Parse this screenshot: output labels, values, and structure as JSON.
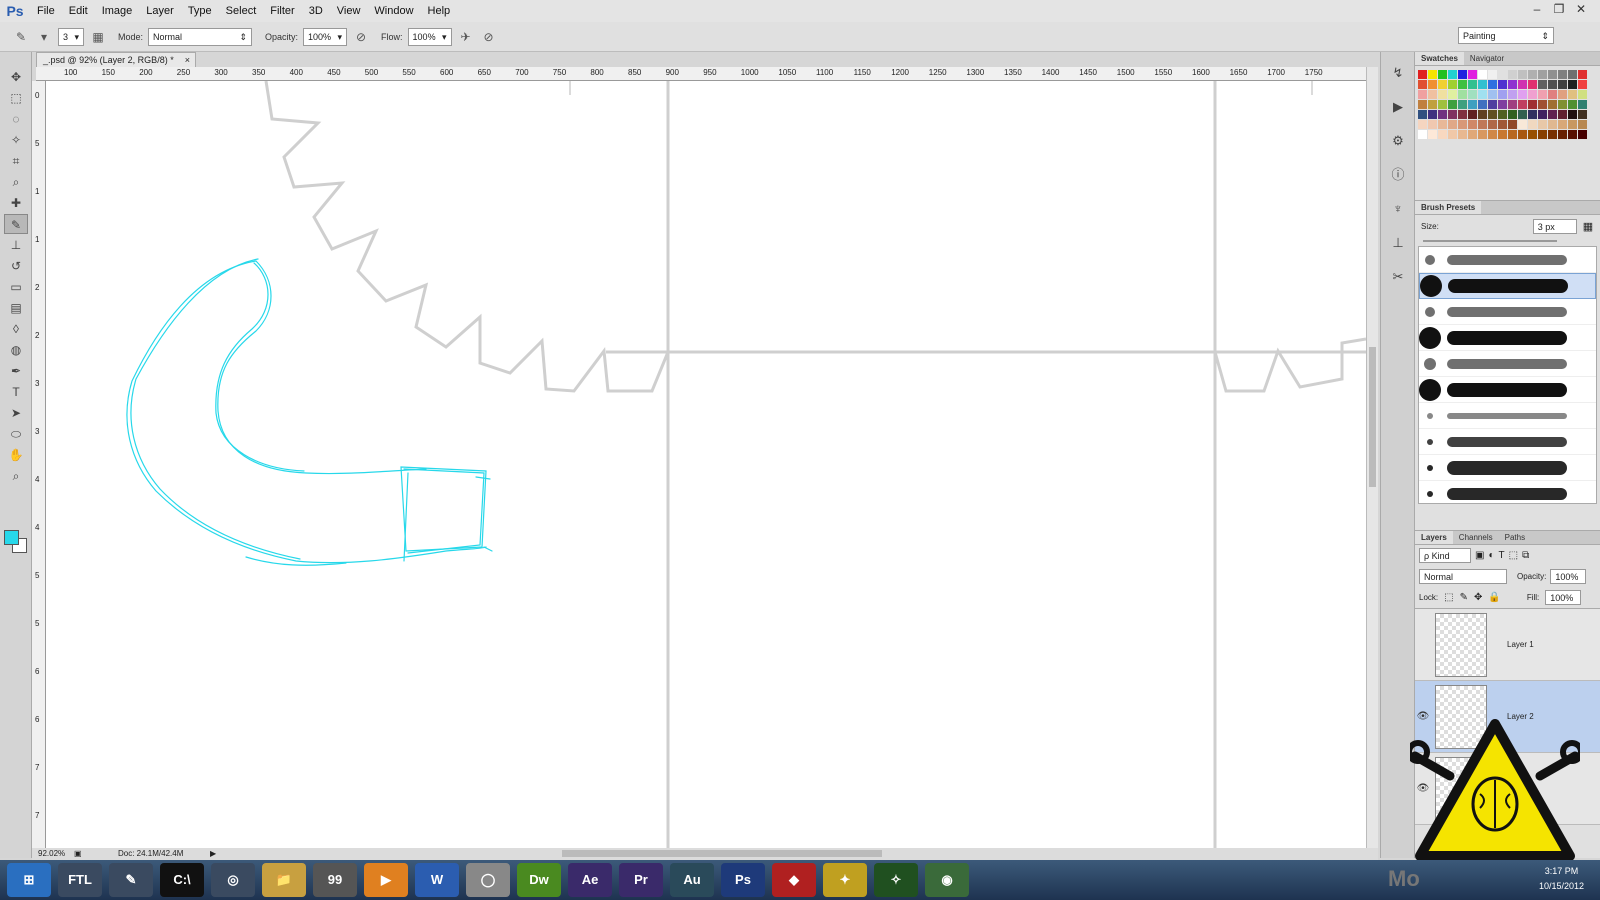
{
  "app": {
    "logo": "Ps"
  },
  "menu": [
    "File",
    "Edit",
    "Image",
    "Layer",
    "Type",
    "Select",
    "Filter",
    "3D",
    "View",
    "Window",
    "Help"
  ],
  "window_controls": [
    "–",
    "❐",
    "✕"
  ],
  "options": {
    "brush_size": "3",
    "mode_label": "Mode:",
    "mode_value": "Normal",
    "opacity_label": "Opacity:",
    "opacity_value": "100%",
    "flow_label": "Flow:",
    "flow_value": "100%",
    "workspace": "Painting"
  },
  "document": {
    "tab_title": "_.psd @ 92% (Layer 2, RGB/8) *",
    "close": "×"
  },
  "ruler_h": [
    "100",
    "150",
    "200",
    "250",
    "300",
    "350",
    "400",
    "450",
    "500",
    "550",
    "600",
    "650",
    "700",
    "750",
    "800",
    "850",
    "900",
    "950",
    "1000",
    "1050",
    "1100",
    "1150",
    "1200",
    "1250",
    "1300",
    "1350",
    "1400",
    "1450",
    "1500",
    "1550",
    "1600",
    "1650",
    "1700",
    "1750"
  ],
  "ruler_v": [
    "0",
    "5",
    "1",
    "1",
    "2",
    "2",
    "3",
    "3",
    "4",
    "4",
    "5",
    "5",
    "6",
    "6",
    "7",
    "7"
  ],
  "status": {
    "zoom": "92.02%",
    "doc": "Doc: 24.1M/42.4M"
  },
  "tools": [
    "move-icon",
    "marquee-icon",
    "lasso-icon",
    "quick-select-icon",
    "crop-icon",
    "eyedropper-icon",
    "healing-icon",
    "brush-icon",
    "stamp-icon",
    "history-brush-icon",
    "eraser-icon",
    "gradient-icon",
    "blur-icon",
    "dodge-icon",
    "pen-icon",
    "type-icon",
    "path-select-icon",
    "shape-icon",
    "hand-icon",
    "zoom-icon"
  ],
  "colors": {
    "foreground": "#27d8ea",
    "background": "#ffffff",
    "sketch": "#27d8ea",
    "guide": "#cfcfcf"
  },
  "swatches_panel": {
    "tabs": [
      "Swatches",
      "Navigator"
    ]
  },
  "swatches": [
    "#e02020",
    "#f5e400",
    "#20c020",
    "#20d0d0",
    "#2020e0",
    "#e020e0",
    "#ffffff",
    "#f0f0f0",
    "#e0e0e0",
    "#d0d0d0",
    "#c0c0c0",
    "#b0b0b0",
    "#a0a0a0",
    "#909090",
    "#808080",
    "#707070",
    "#e03030",
    "#e05030",
    "#f09030",
    "#f0d030",
    "#a0d030",
    "#40c040",
    "#30c090",
    "#30c0d0",
    "#3070e0",
    "#5030d0",
    "#9030d0",
    "#d030b0",
    "#e03070",
    "#606060",
    "#505050",
    "#404040",
    "#202020",
    "#f04040",
    "#f0a0a0",
    "#f0c0a0",
    "#f0e0a0",
    "#e0f0a0",
    "#a0e0a0",
    "#a0e0c0",
    "#a0e0f0",
    "#a0c0f0",
    "#a0a0f0",
    "#c0a0f0",
    "#e0a0f0",
    "#f0a0d0",
    "#f0a0b0",
    "#e08080",
    "#e0a080",
    "#e0c080",
    "#d0e080",
    "#c08040",
    "#c0a040",
    "#a0c040",
    "#40a040",
    "#40a080",
    "#40a0c0",
    "#4070c0",
    "#5040a0",
    "#8040a0",
    "#a04080",
    "#c04060",
    "#a03030",
    "#a05030",
    "#a07030",
    "#809030",
    "#509030",
    "#308070",
    "#305080",
    "#403080",
    "#703080",
    "#803060",
    "#803040",
    "#602020",
    "#604020",
    "#605020",
    "#506020",
    "#306020",
    "#306050",
    "#303060",
    "#402060",
    "#602050",
    "#602030",
    "#201010",
    "#403020",
    "#f5d5c0",
    "#f0c8b0",
    "#e8b898",
    "#e0a888",
    "#d89878",
    "#d08868",
    "#c07858",
    "#b06848",
    "#a05838",
    "#904828",
    "#f8e8d8",
    "#f0d8c0",
    "#e8c8a8",
    "#e0b890",
    "#d8a878",
    "#c89860",
    "#b88850",
    "#ffffff",
    "#fde8d8",
    "#f8d8c0",
    "#f0c8a8",
    "#e8b890",
    "#e0a878",
    "#d89860",
    "#d08848",
    "#c87830",
    "#b86820",
    "#a85810",
    "#985000",
    "#884000",
    "#783000",
    "#682000",
    "#581000",
    "#480000"
  ],
  "brush_panel": {
    "title": "Brush Presets",
    "size_label": "Size:",
    "size_value": "3 px"
  },
  "layers_panel": {
    "tabs": [
      "Layers",
      "Channels",
      "Paths"
    ],
    "kind": "ρ Kind",
    "blend": "Normal",
    "opacity_label": "Opacity:",
    "opacity_value": "100%",
    "lock_label": "Lock:",
    "fill_label": "Fill:",
    "fill_value": "100%"
  },
  "layers": [
    {
      "name": "Layer 1",
      "visible": false
    },
    {
      "name": "Layer 2",
      "visible": true,
      "selected": true
    },
    {
      "name": "",
      "visible": true
    }
  ],
  "taskbar": {
    "items": [
      "⊞",
      "FTL",
      "✎",
      "C:\\",
      "◎",
      "📁",
      "99",
      "▶",
      "W",
      "◯",
      "Dw",
      "Ae",
      "Pr",
      "Au",
      "Ps",
      "◆",
      "✦",
      "✧",
      "◉"
    ],
    "time": "3:17 PM",
    "date": "10/15/2012",
    "tray": "Mo"
  }
}
